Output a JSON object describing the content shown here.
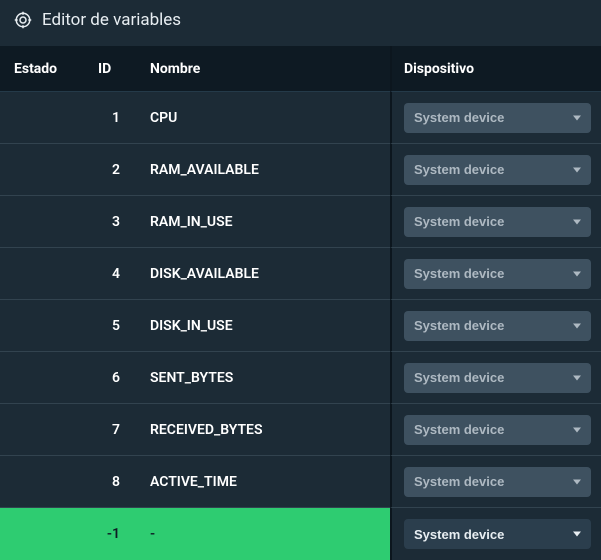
{
  "header": {
    "title": "Editor de variables",
    "icon": "target-icon"
  },
  "columns": {
    "estado": "Estado",
    "id": "ID",
    "nombre": "Nombre",
    "dispositivo": "Dispositivo"
  },
  "device_option": "System device",
  "rows": [
    {
      "id": "1",
      "nombre": "CPU",
      "device": "System device"
    },
    {
      "id": "2",
      "nombre": "RAM_AVAILABLE",
      "device": "System device"
    },
    {
      "id": "3",
      "nombre": "RAM_IN_USE",
      "device": "System device"
    },
    {
      "id": "4",
      "nombre": "DISK_AVAILABLE",
      "device": "System device"
    },
    {
      "id": "5",
      "nombre": "DISK_IN_USE",
      "device": "System device"
    },
    {
      "id": "6",
      "nombre": "SENT_BYTES",
      "device": "System device"
    },
    {
      "id": "7",
      "nombre": "RECEIVED_BYTES",
      "device": "System device"
    },
    {
      "id": "8",
      "nombre": "ACTIVE_TIME",
      "device": "System device"
    }
  ],
  "new_row": {
    "id": "-1",
    "nombre": "-",
    "device": "System device"
  },
  "colors": {
    "bg": "#1c2b36",
    "header_bg": "#0e1a23",
    "new_row_bg": "#2ecc71",
    "select_bg": "#3e5160"
  }
}
